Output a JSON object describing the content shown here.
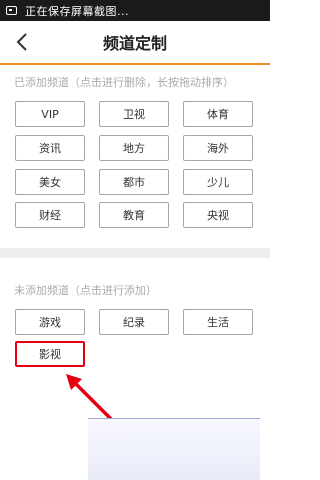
{
  "status_bar": {
    "text": "正在保存屏幕截图..."
  },
  "header": {
    "title": "频道定制"
  },
  "added": {
    "label": "已添加频道（点击进行删除，长按拖动排序）",
    "channels": [
      "VIP",
      "卫视",
      "体育",
      "资讯",
      "地方",
      "海外",
      "美女",
      "都市",
      "少儿",
      "财经",
      "教育",
      "央视"
    ]
  },
  "not_added": {
    "label": "未添加频道（点击进行添加）",
    "channels": [
      "游戏",
      "纪录",
      "生活",
      "影视"
    ]
  },
  "colors": {
    "accent": "#f08c28",
    "highlight": "#e60012",
    "arrow": "#e60012"
  },
  "icons": {
    "back": "chevron-left-icon",
    "notification": "image-notification-icon",
    "arrow": "red-arrow-icon"
  }
}
